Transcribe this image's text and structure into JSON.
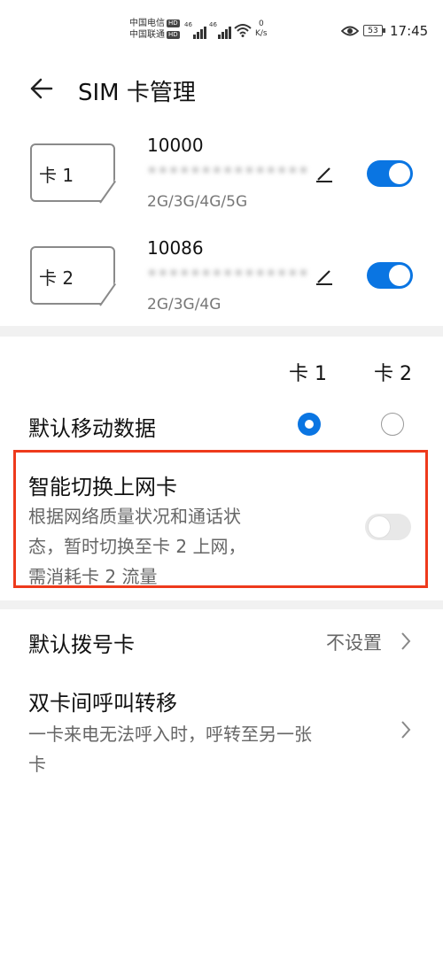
{
  "status_bar": {
    "carrier1": "中国电信",
    "carrier2": "中国联通",
    "hd_badge": "HD",
    "net_type": "46",
    "speed_value": "0",
    "speed_unit": "K/s",
    "battery": "53",
    "time": "17:45"
  },
  "header": {
    "back_icon": "arrow-left-icon",
    "title": "SIM 卡管理"
  },
  "sims": [
    {
      "label": "卡 1",
      "number": "10000",
      "phone_masked": "•••••••••••••••",
      "networks": "2G/3G/4G/5G",
      "enabled": true
    },
    {
      "label": "卡 2",
      "number": "10086",
      "phone_masked": "•••••••••••••••",
      "networks": "2G/3G/4G",
      "enabled": true
    }
  ],
  "columns": {
    "card1": "卡 1",
    "card2": "卡 2"
  },
  "default_data": {
    "label": "默认移动数据",
    "selected": "card1"
  },
  "smart_switch": {
    "title": "智能切换上网卡",
    "desc_line1": "根据网络质量状况和通话状",
    "desc_line2": "态，暂时切换至卡 2 上网，",
    "desc_line3": "需消耗卡 2 流量",
    "enabled": false
  },
  "default_dial": {
    "label": "默认拨号卡",
    "value": "不设置"
  },
  "call_forward": {
    "title": "双卡间呼叫转移",
    "desc_line1": "一卡来电无法呼入时，呼转至另一张",
    "desc_line2": "卡"
  },
  "colors": {
    "accent": "#0a75e2",
    "highlight": "#ee3a1c"
  }
}
